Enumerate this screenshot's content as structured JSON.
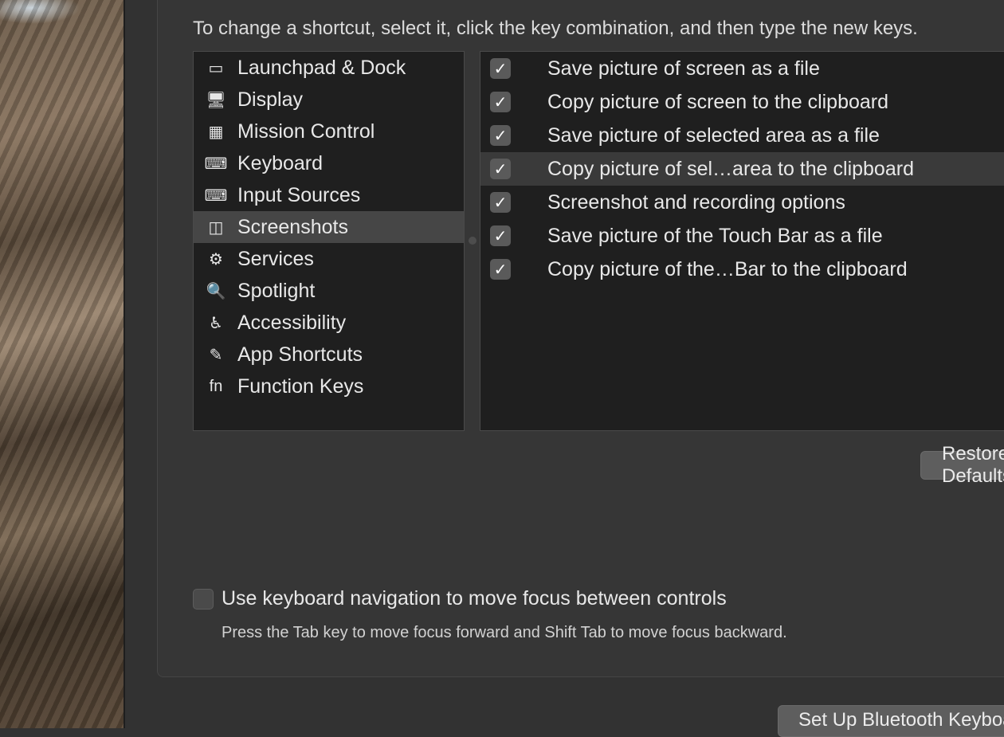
{
  "instruction": "To change a shortcut, select it, click the key combination, and then type the new keys.",
  "categories": [
    {
      "label": "Launchpad & Dock",
      "icon": "launchpad-dock-icon",
      "glyph": "▭"
    },
    {
      "label": "Display",
      "icon": "display-icon",
      "glyph": "🖥"
    },
    {
      "label": "Mission Control",
      "icon": "mission-control-icon",
      "glyph": "▦"
    },
    {
      "label": "Keyboard",
      "icon": "keyboard-icon",
      "glyph": "⌨"
    },
    {
      "label": "Input Sources",
      "icon": "input-sources-icon",
      "glyph": "⌨"
    },
    {
      "label": "Screenshots",
      "icon": "screenshots-icon",
      "glyph": "◫"
    },
    {
      "label": "Services",
      "icon": "gear-icon",
      "glyph": "⚙"
    },
    {
      "label": "Spotlight",
      "icon": "spotlight-icon",
      "glyph": "🔍"
    },
    {
      "label": "Accessibility",
      "icon": "accessibility-icon",
      "glyph": "♿"
    },
    {
      "label": "App Shortcuts",
      "icon": "app-shortcuts-icon",
      "glyph": "✎"
    },
    {
      "label": "Function Keys",
      "icon": "function-keys-icon",
      "glyph": "fn"
    }
  ],
  "selected_category": "Screenshots",
  "shortcuts": [
    {
      "label": "Save picture of screen as a file",
      "checked": true
    },
    {
      "label": "Copy picture of screen to the clipboard",
      "checked": true
    },
    {
      "label": "Save picture of selected area as a file",
      "checked": true
    },
    {
      "label": "Copy picture of sel…area to the clipboard",
      "checked": true
    },
    {
      "label": "Screenshot and recording options",
      "checked": true
    },
    {
      "label": "Save picture of the Touch Bar as a file",
      "checked": true
    },
    {
      "label": "Copy picture of the…Bar to the clipboard",
      "checked": true
    }
  ],
  "selected_shortcut": "Copy picture of sel…area to the clipboard",
  "restore_button": "Restore Defaults",
  "keyboard_nav": {
    "label": "Use keyboard navigation to move focus between controls",
    "hint": "Press the Tab key to move focus forward and Shift Tab to move focus backward.",
    "checked": false
  },
  "bluetooth_button": "Set Up Bluetooth Keyboard…",
  "check_glyph": "✓"
}
